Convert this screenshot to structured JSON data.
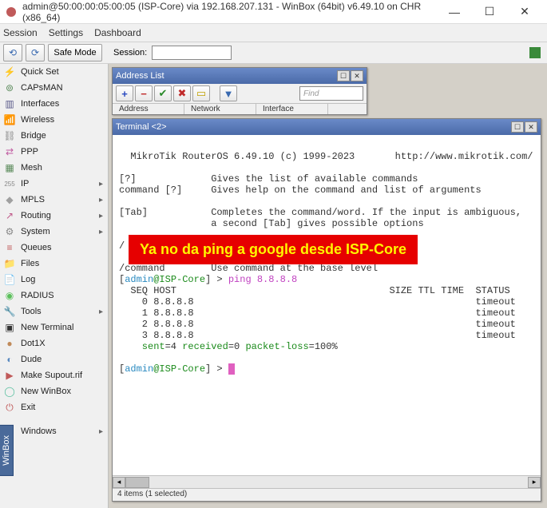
{
  "titlebar": {
    "text": "admin@50:00:00:05:00:05 (ISP-Core) via 192.168.207.131 - WinBox (64bit) v6.49.10 on CHR (x86_64)"
  },
  "menubar": {
    "session": "Session",
    "settings": "Settings",
    "dashboard": "Dashboard"
  },
  "toolbar": {
    "safe_mode": "Safe Mode",
    "session_label": "Session:"
  },
  "sidebar": {
    "items": [
      {
        "icon": "⚡",
        "label": "Quick Set",
        "color": "#c0a000"
      },
      {
        "icon": "⊚",
        "label": "CAPsMAN",
        "color": "#5a8a5a"
      },
      {
        "icon": "▥",
        "label": "Interfaces",
        "color": "#5a5a8a"
      },
      {
        "icon": "📶",
        "label": "Wireless",
        "color": "#5a8ac0"
      },
      {
        "icon": "⛓",
        "label": "Bridge",
        "color": "#888"
      },
      {
        "icon": "⇄",
        "label": "PPP",
        "color": "#c05aa0"
      },
      {
        "icon": "▦",
        "label": "Mesh",
        "color": "#5a8a5a"
      },
      {
        "icon": "255",
        "label": "IP",
        "color": "#888",
        "arrow": true,
        "small": true
      },
      {
        "icon": "◆",
        "label": "MPLS",
        "color": "#a0a0a0",
        "arrow": true
      },
      {
        "icon": "↗",
        "label": "Routing",
        "color": "#c05a8a",
        "arrow": true
      },
      {
        "icon": "⚙",
        "label": "System",
        "color": "#888",
        "arrow": true
      },
      {
        "icon": "≡",
        "label": "Queues",
        "color": "#c05a5a"
      },
      {
        "icon": "📁",
        "label": "Files",
        "color": "#c0a05a"
      },
      {
        "icon": "📄",
        "label": "Log",
        "color": "#eee"
      },
      {
        "icon": "◉",
        "label": "RADIUS",
        "color": "#5ac05a"
      },
      {
        "icon": "🔧",
        "label": "Tools",
        "color": "#888",
        "arrow": true
      },
      {
        "icon": "▣",
        "label": "New Terminal",
        "color": "#333"
      },
      {
        "icon": "●",
        "label": "Dot1X",
        "color": "#c08a5a"
      },
      {
        "icon": "◐",
        "label": "Dude",
        "color": "#5a8ac0"
      },
      {
        "icon": "▶",
        "label": "Make Supout.rif",
        "color": "#c05a5a"
      },
      {
        "icon": "◯",
        "label": "New WinBox",
        "color": "#5ac0a0"
      },
      {
        "icon": "⏻",
        "label": "Exit",
        "color": "#c05a5a"
      }
    ],
    "windows_item": {
      "icon": "▣",
      "label": "Windows",
      "arrow": true
    },
    "vtab": "WinBox"
  },
  "address_list": {
    "title": "Address List",
    "find_placeholder": "Find",
    "cols": {
      "address": "Address",
      "network": "Network",
      "interface": "Interface"
    }
  },
  "terminal": {
    "title": "Terminal <2>",
    "banner": "  MikroTik RouterOS 6.49.10 (c) 1999-2023       http://www.mikrotik.com/",
    "help1": "[?]             Gives the list of available commands",
    "help2": "command [?]     Gives help on the command and list of arguments",
    "help3": "[Tab]           Completes the command/word. If the input is ambiguous,",
    "help4": "                a second [Tab] gives possible options",
    "slash": "/",
    "cmdline": "/command        Use command at the base level",
    "prompt_open": "[",
    "prompt_user": "admin",
    "prompt_at": "@",
    "prompt_host": "ISP-Core",
    "prompt_close": "] > ",
    "ping_cmd": "ping 8.8.8.8",
    "seq_header": "  SEQ HOST                                     SIZE TTL TIME  STATUS",
    "rows": [
      "    0 8.8.8.8                                                 timeout",
      "    1 8.8.8.8                                                 timeout",
      "    2 8.8.8.8                                                 timeout",
      "    3 8.8.8.8                                                 timeout"
    ],
    "stats_sent": "    sent",
    "stats_eq1": "=4 ",
    "stats_recv": "received",
    "stats_eq2": "=0 ",
    "stats_loss": "packet-loss",
    "stats_eq3": "=100%"
  },
  "annotation": "Ya no da ping a google desde ISP-Core",
  "statusbar": "4 items (1 selected)"
}
